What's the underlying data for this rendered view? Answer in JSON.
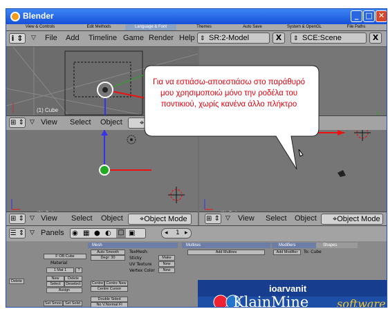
{
  "window": {
    "title": "Blender",
    "min": "_",
    "max": "□",
    "close": "✕"
  },
  "prefs_tabs": [
    "View & Controls",
    "Edit Methods",
    "Language & Font",
    "Themes",
    "Auto Save",
    "System & OpenGL",
    "File Paths"
  ],
  "prefs_active": 2,
  "menu": {
    "file": "File",
    "add": "Add",
    "timeline": "Timeline",
    "game": "Game",
    "render": "Render",
    "help": "Help"
  },
  "screen_selector": "SR:2-Model",
  "scene_selector": "SCE:Scene",
  "close_x": "X",
  "viewport": {
    "object_label": "(1) Cube",
    "view": "View",
    "select": "Select",
    "object": "Object",
    "mode": "Object Mode"
  },
  "bubble": "Για να εστιάσω-αποεστιάσω στο παράθυρό μου χρησιμοποιώ μόνο την ροδέλα του ποντικιού, χωρίς κανένα άλλο πλήκτρο",
  "buttons": {
    "panels": "Panels",
    "page": "1",
    "prev": "◂",
    "next": "▸",
    "link": {
      "ob": "F OB:Cube",
      "material": "Material",
      "mat": "1 Mat 1",
      "q": "?",
      "delete_left": "Delete",
      "new": "New",
      "delete": "Delete",
      "select": "Select",
      "deselect": "Deselect",
      "assign": "Assign",
      "set_smooth": "Set Smoo",
      "set_solid": "Set Solid"
    },
    "mesh": {
      "header": "Mesh",
      "auto_smooth": "Auto Smooth",
      "degr": "Degr: 30",
      "texmesh": "TexMesh:",
      "sticky": "Sticky",
      "make": "Make",
      "uv_texture": "UV Texture",
      "new": "New",
      "vertex_color": "Vertex Color",
      "new2": "New",
      "centre": "Centre",
      "centre_new": "Centre New",
      "centre_cursor": "Centre Cursor",
      "double_sided": "Double Sided",
      "no_vnormal": "No V.Normal Fl"
    },
    "multires": {
      "header": "Multires",
      "add": "Add Multires"
    },
    "modifiers": {
      "header": "Modifiers",
      "shapes": "Shapes",
      "add": "Add Modifier",
      "to": "To: Cube"
    }
  },
  "banner": {
    "user": "ioarvanit",
    "brand": "KlainMine",
    "software": "software"
  }
}
